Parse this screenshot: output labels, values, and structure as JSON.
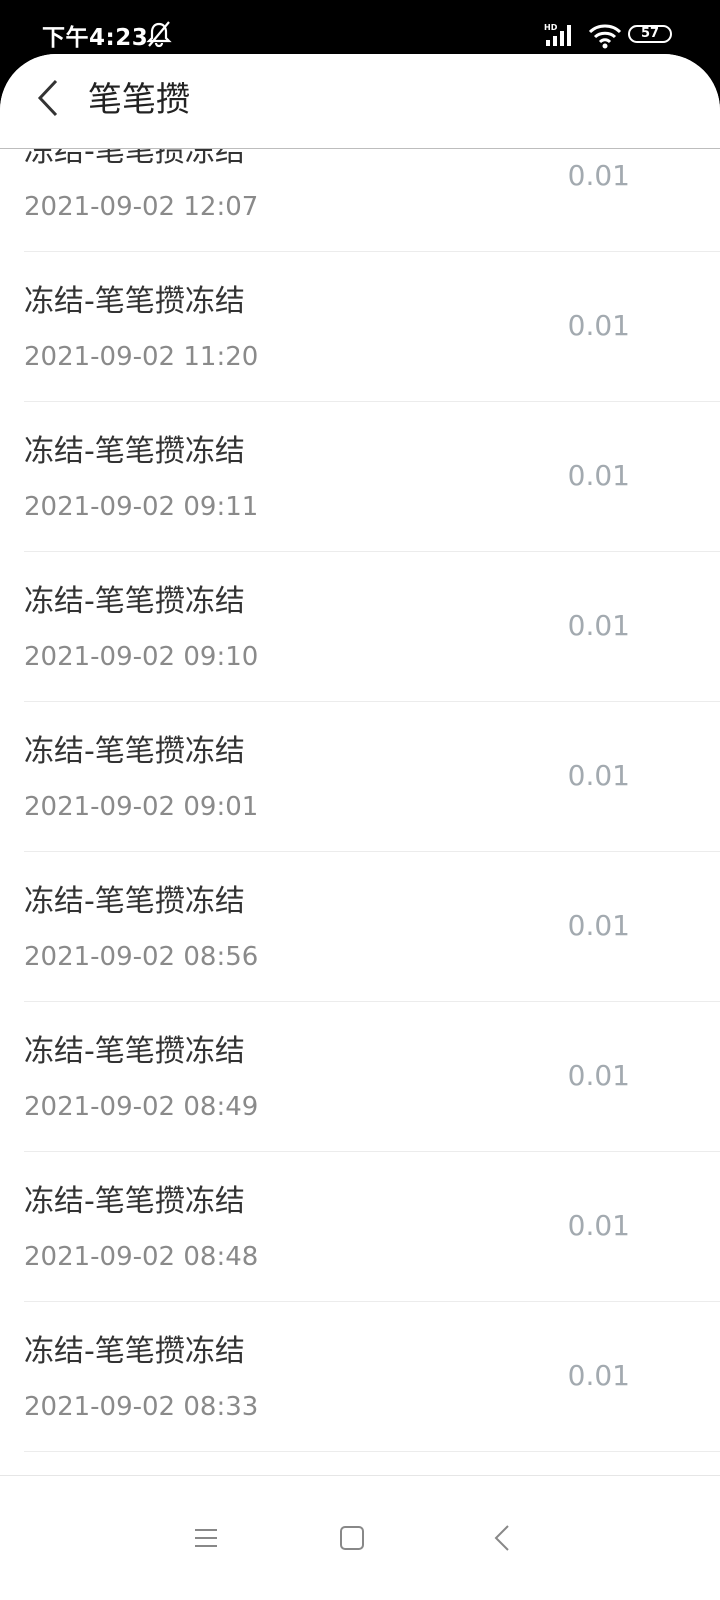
{
  "status_bar": {
    "time": "下午4:23",
    "network_label": "HD",
    "battery_level": "57",
    "icons": [
      "mute-alarm-icon",
      "signal-icon",
      "wifi-icon",
      "battery-icon"
    ]
  },
  "header": {
    "title": "笔笔攒",
    "back_icon": "chevron-left-icon"
  },
  "list": {
    "rows": [
      {
        "title": "冻结-笔笔攒冻结",
        "time": "2021-09-02 12:07",
        "amount": "0.01"
      },
      {
        "title": "冻结-笔笔攒冻结",
        "time": "2021-09-02 11:20",
        "amount": "0.01"
      },
      {
        "title": "冻结-笔笔攒冻结",
        "time": "2021-09-02 09:11",
        "amount": "0.01"
      },
      {
        "title": "冻结-笔笔攒冻结",
        "time": "2021-09-02 09:10",
        "amount": "0.01"
      },
      {
        "title": "冻结-笔笔攒冻结",
        "time": "2021-09-02 09:01",
        "amount": "0.01"
      },
      {
        "title": "冻结-笔笔攒冻结",
        "time": "2021-09-02 08:56",
        "amount": "0.01"
      },
      {
        "title": "冻结-笔笔攒冻结",
        "time": "2021-09-02 08:49",
        "amount": "0.01"
      },
      {
        "title": "冻结-笔笔攒冻结",
        "time": "2021-09-02 08:48",
        "amount": "0.01"
      },
      {
        "title": "冻结-笔笔攒冻结",
        "time": "2021-09-02 08:33",
        "amount": "0.01"
      }
    ]
  },
  "nav_bar": {
    "icons": [
      "menu-icon",
      "home-square-icon",
      "back-triangle-icon"
    ]
  },
  "colors": {
    "title_text": "#333333",
    "time_text": "#8a8a8a",
    "amount_text": "#a3aab0",
    "divider": "#ececec"
  }
}
